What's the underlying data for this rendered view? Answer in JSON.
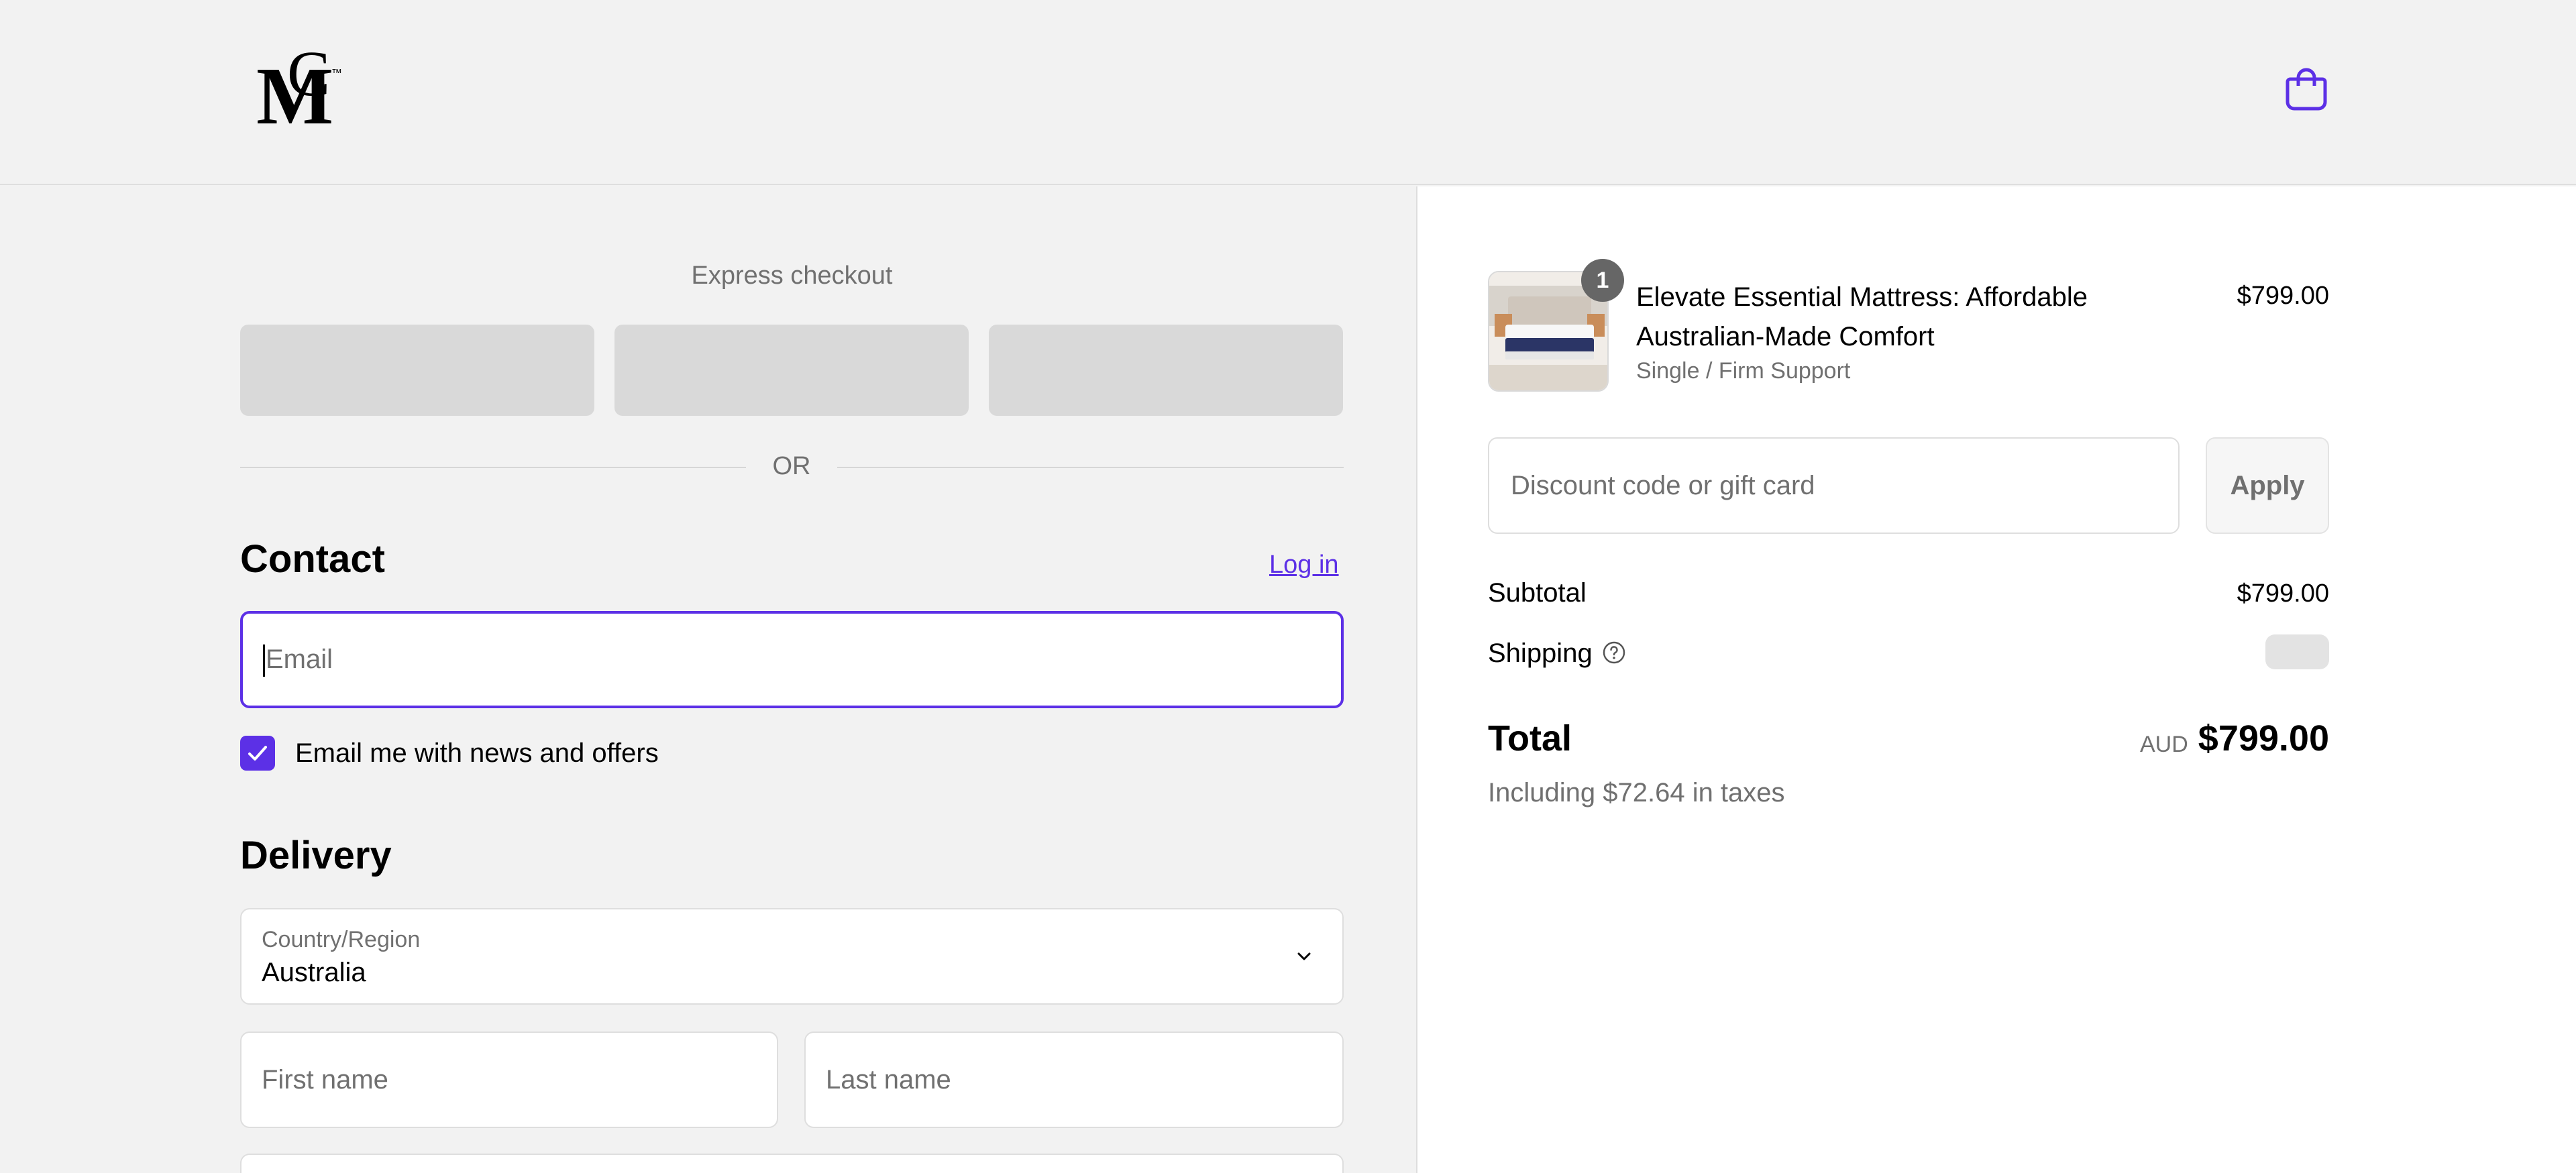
{
  "header": {
    "logo_text": "MC™",
    "cart_icon": "shopping-bag-icon"
  },
  "express": {
    "title": "Express checkout",
    "or_label": "OR"
  },
  "contact": {
    "heading": "Contact",
    "login_label": "Log in",
    "email_placeholder": "Email",
    "email_value": "",
    "news_label": "Email me with news and offers",
    "news_checked": true
  },
  "delivery": {
    "heading": "Delivery",
    "country_label": "Country/Region",
    "country_value": "Australia",
    "first_name_placeholder": "First name",
    "last_name_placeholder": "Last name"
  },
  "summary": {
    "item": {
      "quantity": "1",
      "name": "Elevate Essential Mattress: Affordable Australian-Made Comfort",
      "variant": "Single / Firm Support",
      "price": "$799.00"
    },
    "discount_placeholder": "Discount code or gift card",
    "apply_label": "Apply",
    "subtotal_label": "Subtotal",
    "subtotal_value": "$799.00",
    "shipping_label": "Shipping",
    "total_label": "Total",
    "currency": "AUD",
    "total_value": "$799.00",
    "taxes_note": "Including $72.64 in taxes"
  },
  "colors": {
    "accent": "#5c30e6",
    "background": "#f2f2f2",
    "panel": "#ffffff",
    "muted_text": "#707070"
  }
}
